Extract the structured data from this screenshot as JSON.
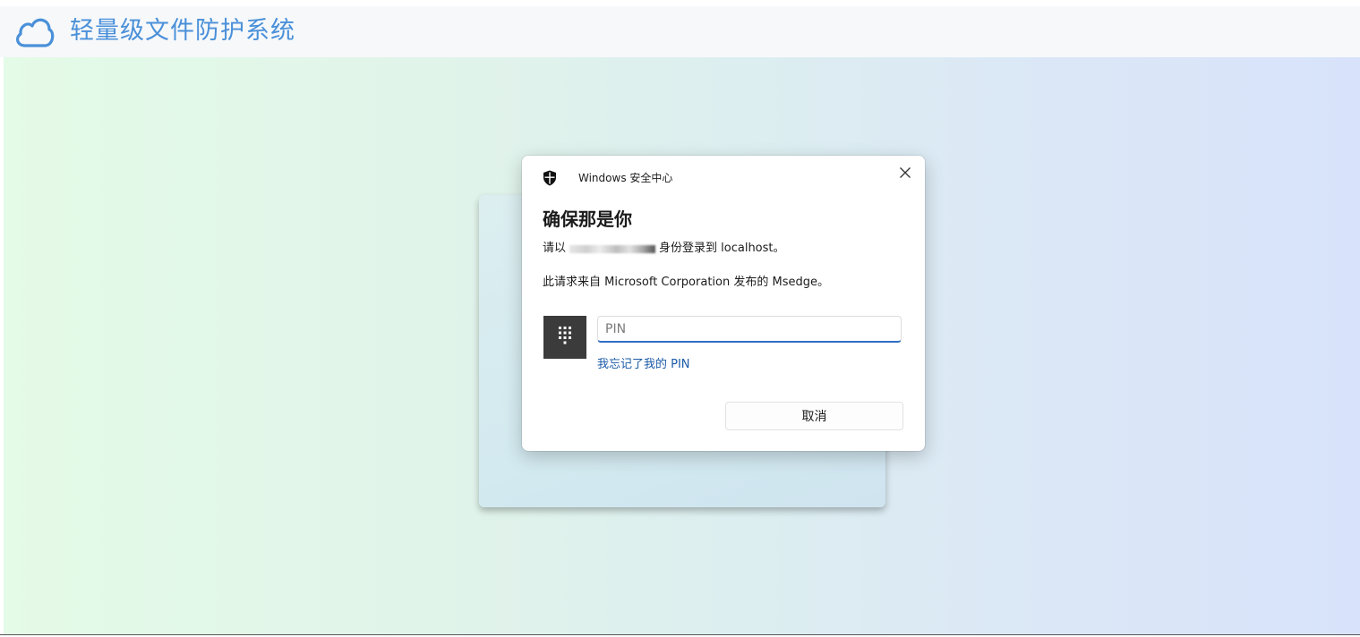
{
  "header": {
    "app_title": "轻量级文件防护系统",
    "logo_icon": "cloud-icon",
    "accent_color": "#4a90d9"
  },
  "dialog": {
    "source_label": "Windows 安全中心",
    "heading": "确保那是你",
    "signin_prefix": "请以",
    "signin_suffix": "身份登录到 localhost。",
    "request_source": "此请求来自 Microsoft Corporation 发布的 Msedge。",
    "pin_placeholder": "PIN",
    "pin_value": "",
    "forgot_pin_label": "我忘记了我的 PIN",
    "cancel_label": "取消",
    "icons": [
      "shield-icon",
      "close-icon",
      "pin-pad-icon"
    ],
    "accent_color": "#2f6fc4"
  }
}
